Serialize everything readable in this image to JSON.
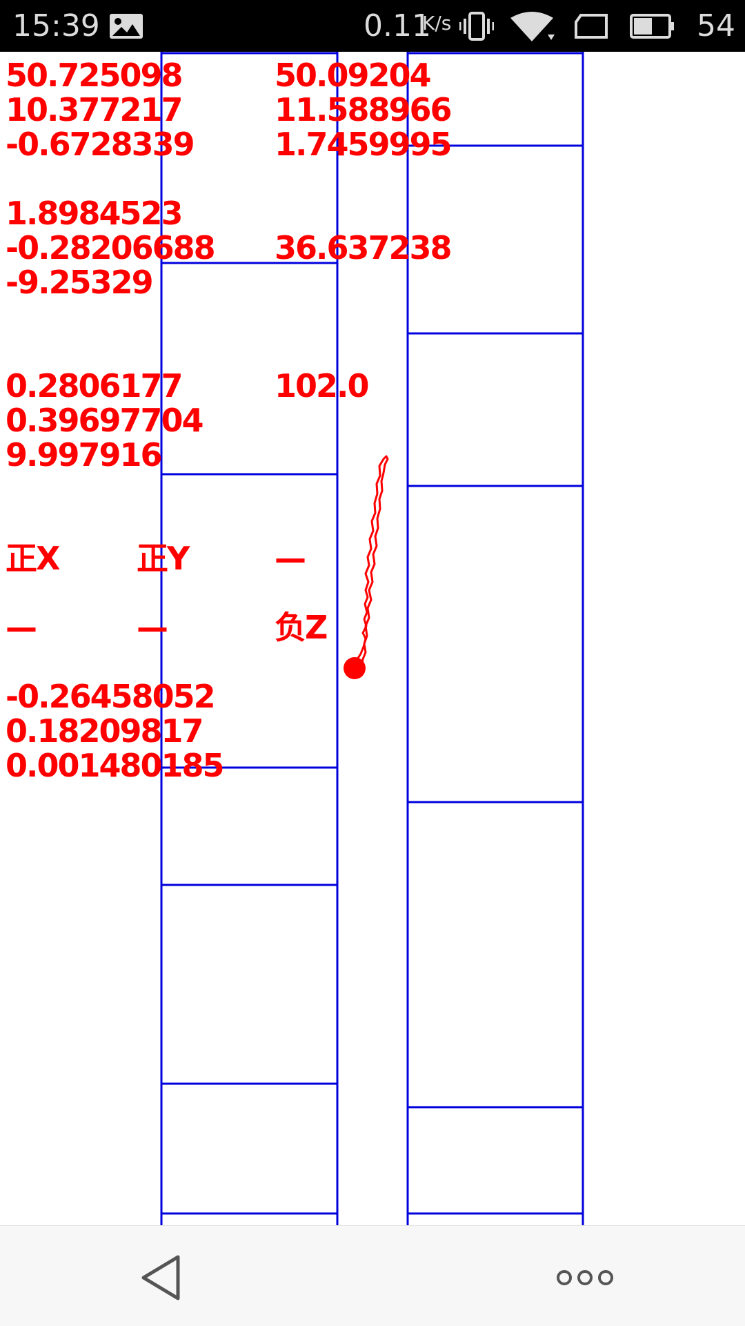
{
  "status_bar": {
    "time": "15:39",
    "net_speed": "0.11",
    "net_speed_unit": "K/s",
    "battery_level": "54",
    "icons": [
      "image-icon",
      "vibrate-icon",
      "wifi-icon",
      "sim-card-icon",
      "battery-icon"
    ]
  },
  "readings": {
    "col_left": {
      "group1": [
        "50.725098",
        "10.377217",
        "-0.6728339"
      ],
      "group2": [
        "1.8984523",
        "-0.28206688",
        "-9.25329"
      ],
      "group3": [
        "0.2806177",
        "0.39697704",
        "9.997916"
      ],
      "group4": [
        "-0.26458052",
        "0.18209817",
        "0.001480185"
      ]
    },
    "col_right": {
      "group1": [
        "50.09204",
        "11.588966",
        "1.7459995"
      ],
      "value2": "36.637238",
      "value3": "102.0"
    },
    "orientation": {
      "row1": [
        "正X",
        "正Y",
        "—"
      ],
      "row2": [
        "—",
        "—",
        "负Z"
      ]
    }
  },
  "colors": {
    "text": "#ff0000",
    "grid": "#0000dd",
    "trace": "#ff0000",
    "status_bar_bg": "#000000",
    "nav_bar_bg": "#f7f7f7"
  },
  "nav_bar": {
    "icons": [
      "back-icon",
      "more-icon"
    ]
  }
}
